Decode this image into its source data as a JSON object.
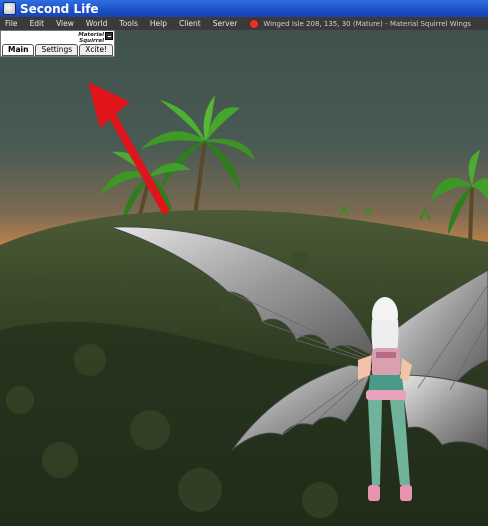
{
  "window": {
    "title": "Second Life",
    "app_icon": "second-life-hand-icon"
  },
  "menubar": {
    "items": [
      "File",
      "Edit",
      "View",
      "World",
      "Tools",
      "Help",
      "Client",
      "Server"
    ],
    "location_icon": "location-pin-icon",
    "location_text": "Winged Isle 208, 135, 30 (Mature) - Material Squirrel Wings"
  },
  "panel": {
    "logo_line1": "Material",
    "logo_line2": "Squirrel",
    "close_icon": "minimize-icon",
    "tabs": [
      {
        "label": "Main",
        "active": true
      },
      {
        "label": "Settings",
        "active": false
      },
      {
        "label": "Xcite!",
        "active": false
      }
    ]
  },
  "colors": {
    "titlebar": "#1c4fc6",
    "menubar": "#3a3a3a",
    "arrow": "#e0141b"
  }
}
